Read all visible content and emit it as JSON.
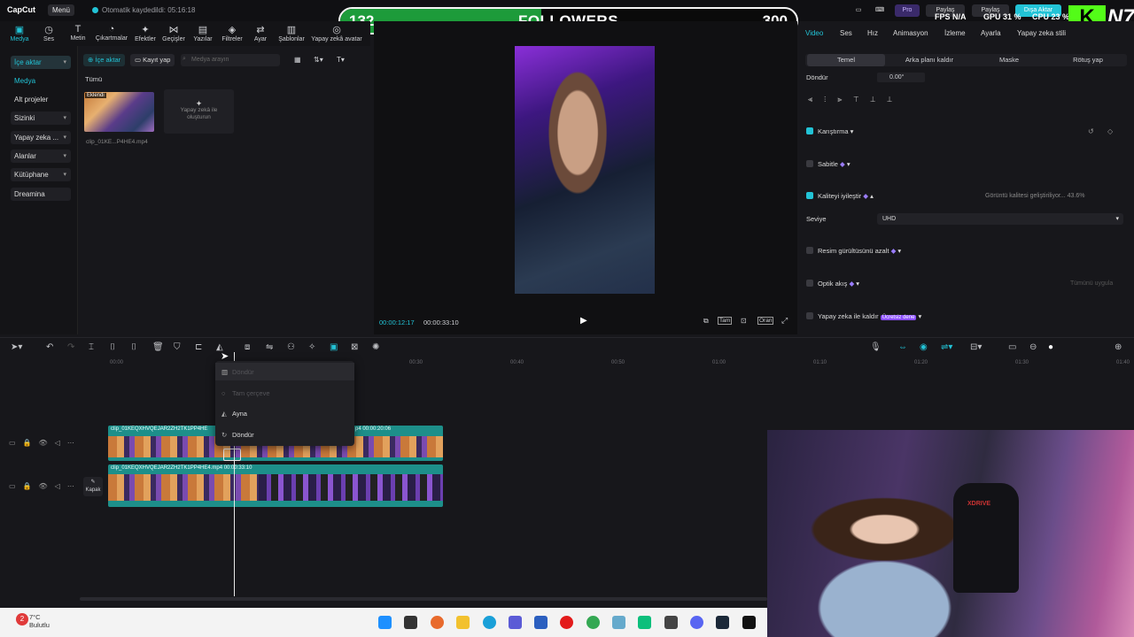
{
  "app": {
    "logo": "CapCut",
    "menu_label": "Menü",
    "autosave_text": "Otomatik kaydedildi: 05:16:18",
    "pro_label": "Pro",
    "share_label": "Paylaş",
    "share2_label": "Paylaş",
    "export_label": "Dışa Aktar"
  },
  "overlay": {
    "followers_current": "132",
    "followers_label": "FOLLOWERS",
    "followers_goal": "300",
    "progress": 0.44,
    "fps_label": "FPS",
    "fps_value": "N/A",
    "gpu_label": "GPU",
    "gpu_value": "31 %",
    "cpu_label": "CPU",
    "cpu_value": "23 %",
    "kick_letter": "K",
    "n7": "N7"
  },
  "tooltabs": [
    {
      "label": "Medya",
      "icon": "media-icon"
    },
    {
      "label": "Ses",
      "icon": "audio-icon"
    },
    {
      "label": "Metin",
      "icon": "text-icon"
    },
    {
      "label": "Çıkartmalar",
      "icon": "sticker-icon"
    },
    {
      "label": "Efektler",
      "icon": "effects-icon"
    },
    {
      "label": "Geçişler",
      "icon": "transitions-icon"
    },
    {
      "label": "Yazılar",
      "icon": "captions-icon"
    },
    {
      "label": "Filtreler",
      "icon": "filters-icon"
    },
    {
      "label": "Ayar",
      "icon": "adjust-icon"
    },
    {
      "label": "Şablonlar",
      "icon": "templates-icon"
    },
    {
      "label": "Yapay zekâ avatar",
      "icon": "avatar-icon"
    }
  ],
  "leftnav": [
    {
      "label": "İçe aktar",
      "arrow": "▾"
    },
    {
      "label": "Medya",
      "arrow": ""
    },
    {
      "label": "Alt projeler",
      "arrow": ""
    },
    {
      "label": "Sizinki",
      "arrow": "▾"
    },
    {
      "label": "Yapay zeka ...",
      "arrow": "▾"
    },
    {
      "label": "Alanlar",
      "arrow": "▾"
    },
    {
      "label": "Kütüphane",
      "arrow": "▾"
    },
    {
      "label": "Dreamina",
      "arrow": ""
    }
  ],
  "media": {
    "import_label": "İçe aktar",
    "record_label": "Kayıt yap",
    "search_placeholder": "Medya arayın",
    "all_label": "Tümü",
    "clip_badge": "Eklendi",
    "clip_name": "clip_01KE...P4HE4.mp4",
    "gen_label_1": "Yapay zekâ ile",
    "gen_label_2": "oluşturun"
  },
  "preview": {
    "current_time": "00:00:12:17",
    "total_time": "00:00:33:10",
    "fit_label": "Tam",
    "ratio_label": "Oran"
  },
  "inspector": {
    "tabs": [
      "Video",
      "Ses",
      "Hız",
      "Animasyon",
      "İzleme",
      "Ayarla",
      "Yapay zeka stili"
    ],
    "subtabs": [
      "Temel",
      "Arka planı kaldır",
      "Maske",
      "Rötuş yap"
    ],
    "rotate_label": "Döndür",
    "rotate_value": "0.00°",
    "blend_label": "Karıştırma",
    "stabilize_label": "Sabitle",
    "enhance_label": "Kaliteyi iyileştir",
    "enhance_status": "Görüntü kalitesi geliştiriliyor... 43.6%",
    "level_label": "Seviye",
    "level_value": "UHD",
    "denoise_label": "Resim gürültüsünü azalt",
    "optical_label": "Optik akış",
    "apply_all": "Tümünü uygula",
    "ai_remove_label": "Yapay zeka ile kaldır",
    "free_badge": "Ücretsiz dene"
  },
  "timeline": {
    "ruler": [
      "00:00",
      "00:30",
      "00:40",
      "00:50",
      "01:00",
      "01:10",
      "01:20",
      "01:30",
      "01:40"
    ],
    "clip1_name": "clip_01KEQXHVQEJAR2ZH2TK1PP4HE",
    "clip1b_name": "p4  00:00:20:06",
    "clip2_name": "clip_01KEQXHVQEJAR2ZH2TK1PP4HE4.mp4  00:00:33:10",
    "cover_label": "Kapak"
  },
  "dropdown": {
    "items": [
      {
        "label": "Döndür",
        "disabled": true
      },
      {
        "label": "Tam çerçeve",
        "disabled": true
      },
      {
        "label": "Ayna",
        "disabled": false
      },
      {
        "label": "Döndür",
        "disabled": false
      }
    ]
  },
  "taskbar": {
    "temp": "7°C",
    "weather": "Bulutlu",
    "badge": "2"
  },
  "colors": {
    "accent": "#22c3d6",
    "progress_green": "#1d9b3a",
    "clip_teal": "#1d8f8a",
    "kick_green": "#53fc18"
  }
}
